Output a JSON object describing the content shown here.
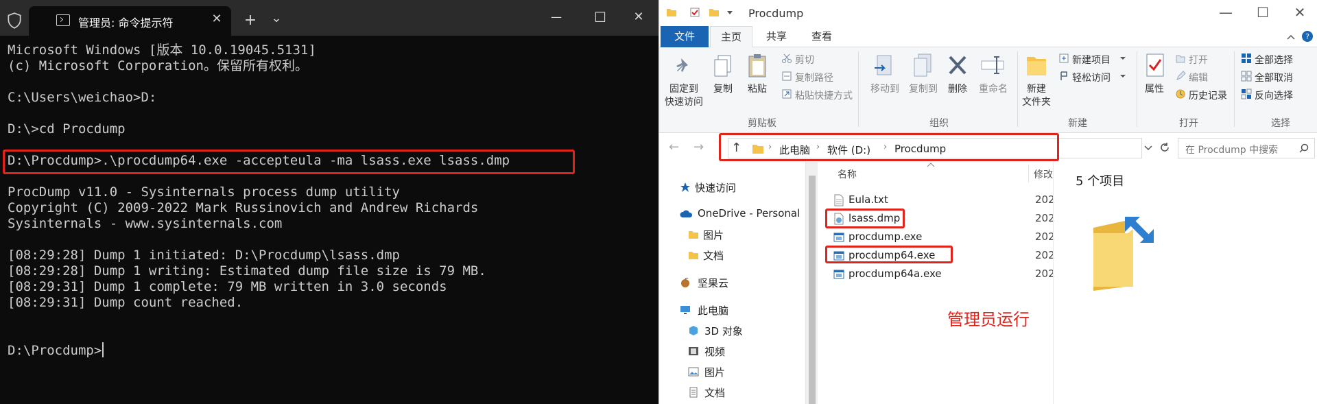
{
  "terminal": {
    "tab_title": "管理员: 命令提示符",
    "lines": [
      "Microsoft Windows [版本 10.0.19045.5131]",
      "(c) Microsoft Corporation。保留所有权利。",
      "",
      "C:\\Users\\weichao>D:",
      "",
      "D:\\>cd Procdump",
      "",
      "D:\\Procdump>.\\procdump64.exe -accepteula -ma lsass.exe lsass.dmp",
      "",
      "ProcDump v11.0 - Sysinternals process dump utility",
      "Copyright (C) 2009-2022 Mark Russinovich and Andrew Richards",
      "Sysinternals - www.sysinternals.com",
      "",
      "[08:29:28] Dump 1 initiated: D:\\Procdump\\lsass.dmp",
      "[08:29:28] Dump 1 writing: Estimated dump file size is 79 MB.",
      "[08:29:31] Dump 1 complete: 79 MB written in 3.0 seconds",
      "[08:29:31] Dump count reached.",
      "",
      "",
      "D:\\Procdump>"
    ],
    "new_tab_glyph": "+",
    "dropdown_glyph": "⌄",
    "minimize_glyph": "—",
    "maximize_glyph": "☐",
    "close_glyph": "✕"
  },
  "explorer": {
    "title": "Procdump",
    "ribbon_tabs": [
      "文件",
      "主页",
      "共享",
      "查看"
    ],
    "ribbon": {
      "clipboard": {
        "label": "剪贴板",
        "pin_label_1": "固定到",
        "pin_label_2": "快速访问",
        "copy": "复制",
        "paste": "粘贴",
        "cut": "剪切",
        "copy_path": "复制路径",
        "paste_shortcut": "粘贴快捷方式"
      },
      "organize": {
        "label": "组织",
        "move_to": "移动到",
        "copy_to": "复制到",
        "delete": "删除",
        "rename": "重命名"
      },
      "new": {
        "label": "新建",
        "new_folder_1": "新建",
        "new_folder_2": "文件夹",
        "new_item": "新建项目",
        "easy_access": "轻松访问"
      },
      "open": {
        "label": "打开",
        "properties": "属性",
        "open": "打开",
        "edit": "编辑",
        "history": "历史记录"
      },
      "select": {
        "label": "选择",
        "select_all": "全部选择",
        "select_none": "全部取消",
        "invert": "反向选择"
      }
    },
    "address": [
      "此电脑",
      "软件 (D:)",
      "Procdump"
    ],
    "search_placeholder": "在 Procdump 中搜索",
    "nav": {
      "quick_access": "快速访问",
      "onedrive": "OneDrive - Personal",
      "pictures": "图片",
      "documents": "文档",
      "jianguoyun": "坚果云",
      "this_pc": "此电脑",
      "objects3d": "3D 对象",
      "videos": "视频",
      "pictures2": "图片",
      "documents2": "文档"
    },
    "columns": {
      "name": "名称",
      "modified": "修改"
    },
    "files": [
      {
        "name": "Eula.txt",
        "date": "202"
      },
      {
        "name": "lsass.dmp",
        "date": "202"
      },
      {
        "name": "procdump.exe",
        "date": "202"
      },
      {
        "name": "procdump64.exe",
        "date": "202"
      },
      {
        "name": "procdump64a.exe",
        "date": "202"
      }
    ],
    "item_count": "5 个项目",
    "annotation": "管理员运行"
  }
}
